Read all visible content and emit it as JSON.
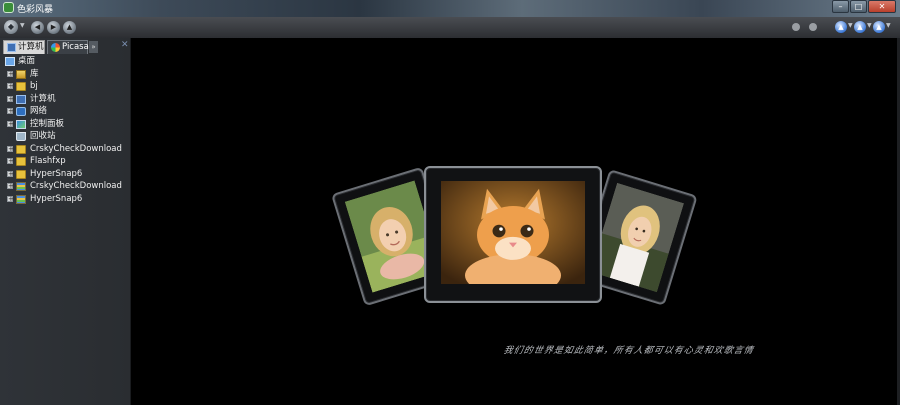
{
  "window": {
    "title": "色彩风暴",
    "minimize": "–",
    "maximize": "□",
    "close": "✕"
  },
  "toolbar": {
    "menu_glyph": "▼",
    "back": "◀",
    "forward": "▶",
    "up": "▲"
  },
  "sidebar": {
    "tabs": [
      {
        "label": "计算机",
        "active": true
      },
      {
        "label": "Picasa",
        "active": false
      }
    ],
    "more": "»",
    "pin": "✕",
    "tree": [
      {
        "label": "桌面",
        "icon": "desktop",
        "expandable": false,
        "root": true
      },
      {
        "label": "库",
        "icon": "lib",
        "expandable": true
      },
      {
        "label": "bj",
        "icon": "folder",
        "expandable": true
      },
      {
        "label": "计算机",
        "icon": "computer",
        "expandable": true
      },
      {
        "label": "网络",
        "icon": "network",
        "expandable": true
      },
      {
        "label": "控制面板",
        "icon": "panel",
        "expandable": true
      },
      {
        "label": "回收站",
        "icon": "bin",
        "expandable": false
      },
      {
        "label": "CrskyCheckDownload",
        "icon": "folder",
        "expandable": true
      },
      {
        "label": "Flashfxp",
        "icon": "folder",
        "expandable": true
      },
      {
        "label": "HyperSnap6",
        "icon": "folder",
        "expandable": true
      },
      {
        "label": "CrskyCheckDownload",
        "icon": "archive",
        "expandable": true
      },
      {
        "label": "HyperSnap6",
        "icon": "archive",
        "expandable": true
      }
    ]
  },
  "viewer": {
    "caption": "我们的世界是如此简单，所有人都可以有心灵和欢歌言情",
    "photos": [
      {
        "name": "girl-portrait",
        "subject": "girl"
      },
      {
        "name": "kitten-photo",
        "subject": "kitten"
      },
      {
        "name": "woman-portrait",
        "subject": "woman"
      }
    ]
  },
  "colors": {
    "background": "#000000",
    "sidebar": "#2d3035",
    "toolbar": "#3a3d42",
    "accent_blue": "#3d79d6"
  }
}
